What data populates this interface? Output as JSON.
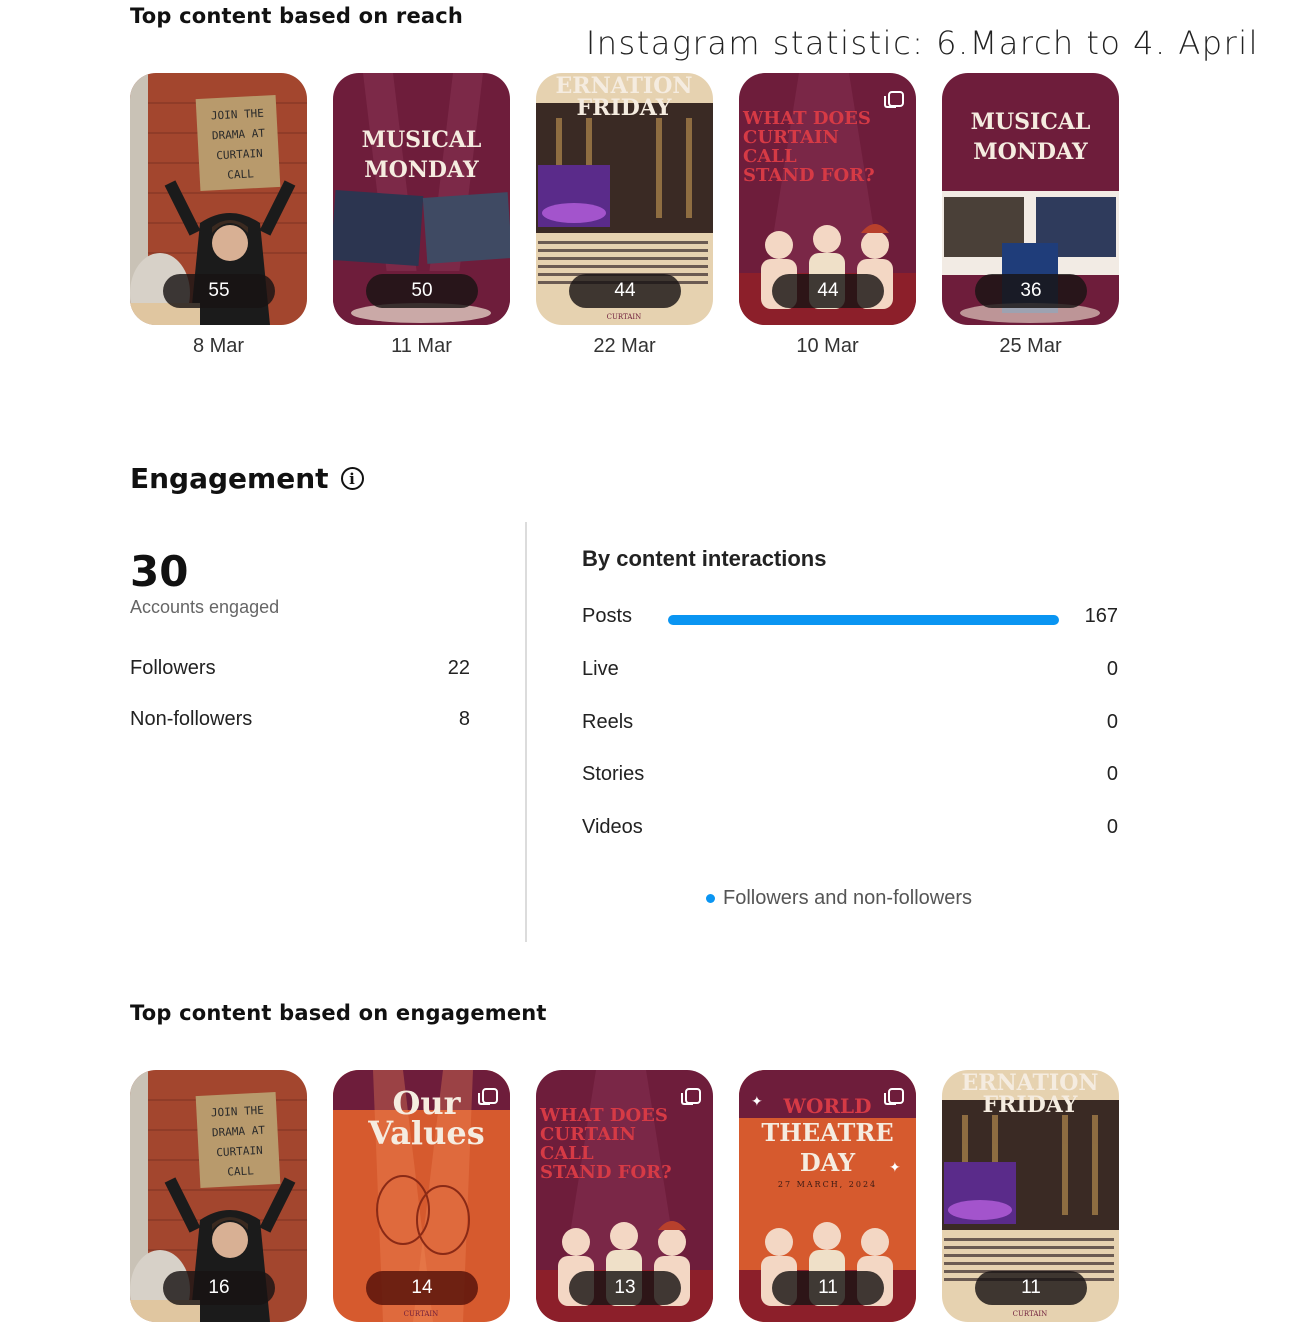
{
  "page_title": "Instagram statistic: 6.March to 4. April",
  "reach": {
    "title": "Top content based on reach",
    "items": [
      {
        "value": "55",
        "date": "8 Mar",
        "sign_lines": [
          "JOIN THE",
          "DRAMA AT",
          "CURTAIN",
          "CALL"
        ]
      },
      {
        "value": "50",
        "date": "11 Mar",
        "poster_lines": [
          "MUSICAL",
          "MONDAY"
        ]
      },
      {
        "value": "44",
        "date": "22 Mar",
        "poster_lines": [
          "ERNATION",
          "FRIDAY"
        ]
      },
      {
        "value": "44",
        "date": "10 Mar",
        "poster_lines": [
          "WHAT DOES",
          "CURTAIN",
          "CALL",
          "STAND FOR?"
        ]
      },
      {
        "value": "36",
        "date": "25 Mar",
        "poster_lines": [
          "MUSICAL",
          "MONDAY"
        ]
      }
    ]
  },
  "engagement": {
    "title": "Engagement",
    "total": "30",
    "total_label": "Accounts engaged",
    "breakdown": [
      {
        "label": "Followers",
        "value": "22"
      },
      {
        "label": "Non-followers",
        "value": "8"
      }
    ],
    "interactions_title": "By content interactions",
    "interactions": [
      {
        "label": "Posts",
        "value": "167",
        "share": 1.0
      },
      {
        "label": "Live",
        "value": "0",
        "share": 0
      },
      {
        "label": "Reels",
        "value": "0",
        "share": 0
      },
      {
        "label": "Stories",
        "value": "0",
        "share": 0
      },
      {
        "label": "Videos",
        "value": "0",
        "share": 0
      }
    ],
    "legend": "Followers and non-followers",
    "bar_color": "#0a95f2"
  },
  "top_engagement": {
    "title": "Top content based on engagement",
    "items": [
      {
        "value": "16",
        "sign_lines": [
          "JOIN THE",
          "DRAMA AT",
          "CURTAIN",
          "CALL"
        ]
      },
      {
        "value": "14",
        "poster_lines": [
          "Our",
          "Values"
        ]
      },
      {
        "value": "13",
        "poster_lines": [
          "WHAT DOES",
          "CURTAIN",
          "CALL",
          "STAND FOR?"
        ]
      },
      {
        "value": "11",
        "poster_lines": [
          "WORLD",
          "THEATRE",
          "DAY",
          "27 MARCH, 2024"
        ]
      },
      {
        "value": "11",
        "poster_lines": [
          "ERNATION",
          "FRIDAY"
        ]
      }
    ]
  },
  "colors": {
    "maroon": "#6e1d3b",
    "orange": "#d65a2e",
    "brick": "#a3462e",
    "cream": "#e6d2b0"
  }
}
